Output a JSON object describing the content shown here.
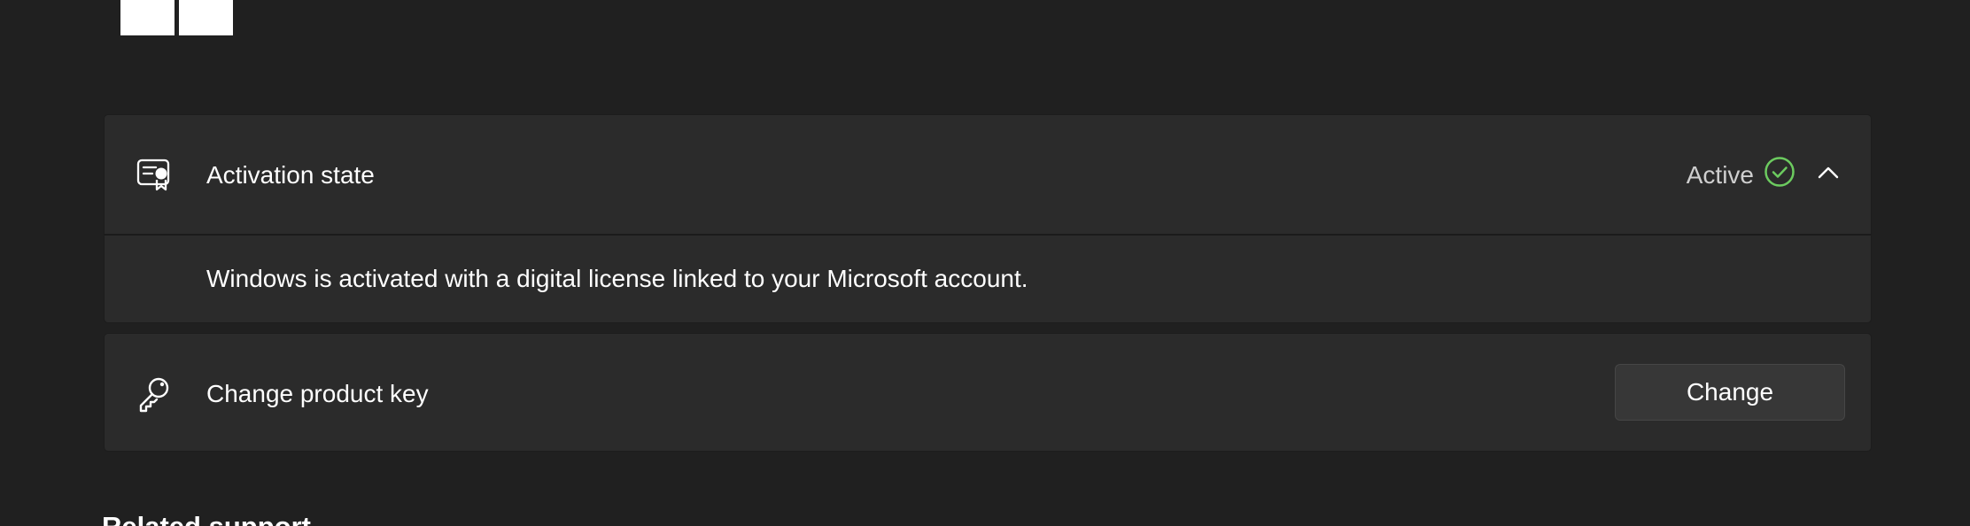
{
  "header": {
    "logo_icon": "windows-logo-icon"
  },
  "activation": {
    "icon": "certificate-icon",
    "label": "Activation state",
    "status": "Active",
    "status_icon": "check-circle-icon",
    "status_color": "#6ccb5f",
    "expand_icon": "chevron-up-icon",
    "detail": "Windows is activated with a digital license linked to your Microsoft account."
  },
  "product_key": {
    "icon": "key-icon",
    "label": "Change product key",
    "button_label": "Change"
  },
  "related_support": {
    "heading": "Related support"
  },
  "theme": {
    "background": "#202020",
    "card_background": "#2b2b2b",
    "text_primary": "#ffffff",
    "text_secondary": "#cfcfcf"
  }
}
